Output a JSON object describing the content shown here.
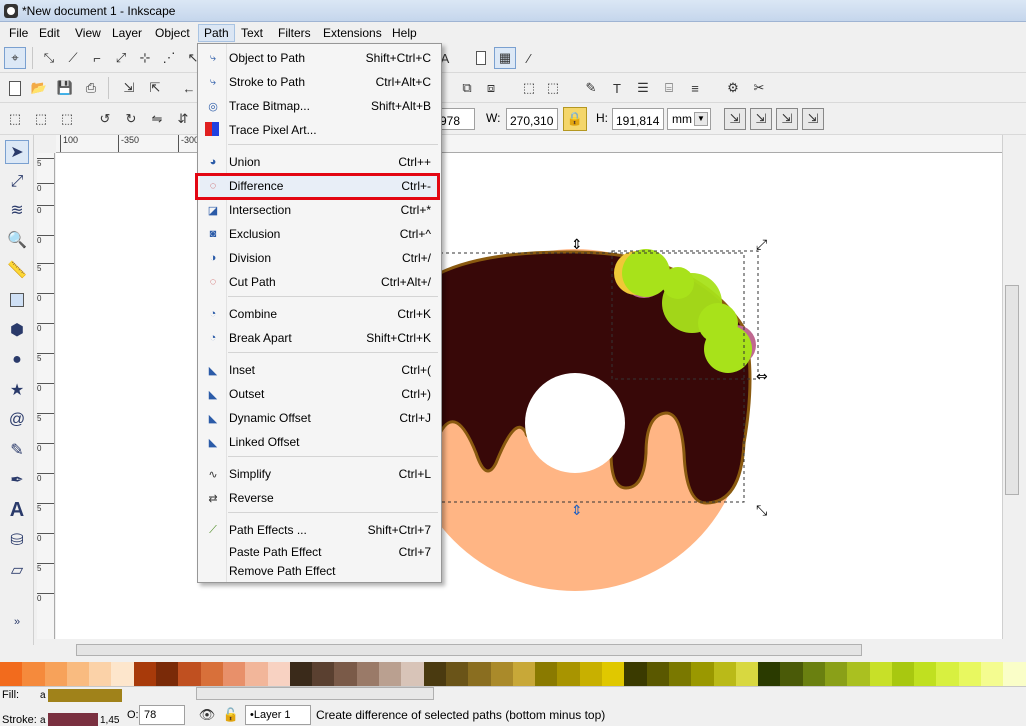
{
  "window": {
    "title": "*New document 1 - Inkscape"
  },
  "menubar": {
    "items": [
      "File",
      "Edit",
      "View",
      "Layer",
      "Object",
      "Path",
      "Text",
      "Filters",
      "Extensions",
      "Help"
    ],
    "active": "Path"
  },
  "path_menu": {
    "items": [
      {
        "label": "Object to Path",
        "shortcut": "Shift+Ctrl+C",
        "icon": "object-to-path-icon"
      },
      {
        "label": "Stroke to Path",
        "shortcut": "Ctrl+Alt+C",
        "icon": "stroke-to-path-icon"
      },
      {
        "label": "Trace Bitmap...",
        "shortcut": "Shift+Alt+B",
        "icon": "trace-bitmap-icon"
      },
      {
        "label": "Trace Pixel Art...",
        "shortcut": "",
        "icon": "trace-pixel-art-icon"
      },
      {
        "label": "Union",
        "shortcut": "Ctrl++",
        "icon": "union-icon"
      },
      {
        "label": "Difference",
        "shortcut": "Ctrl+-",
        "icon": "difference-icon"
      },
      {
        "label": "Intersection",
        "shortcut": "Ctrl+*",
        "icon": "intersection-icon"
      },
      {
        "label": "Exclusion",
        "shortcut": "Ctrl+^",
        "icon": "exclusion-icon"
      },
      {
        "label": "Division",
        "shortcut": "Ctrl+/",
        "icon": "division-icon"
      },
      {
        "label": "Cut Path",
        "shortcut": "Ctrl+Alt+/",
        "icon": "cut-path-icon"
      },
      {
        "label": "Combine",
        "shortcut": "Ctrl+K",
        "icon": "combine-icon"
      },
      {
        "label": "Break Apart",
        "shortcut": "Shift+Ctrl+K",
        "icon": "break-apart-icon"
      },
      {
        "label": "Inset",
        "shortcut": "Ctrl+(",
        "icon": "inset-icon"
      },
      {
        "label": "Outset",
        "shortcut": "Ctrl+)",
        "icon": "outset-icon"
      },
      {
        "label": "Dynamic Offset",
        "shortcut": "Ctrl+J",
        "icon": "dynamic-offset-icon"
      },
      {
        "label": "Linked Offset",
        "shortcut": "",
        "icon": "linked-offset-icon"
      },
      {
        "label": "Simplify",
        "shortcut": "Ctrl+L",
        "icon": "simplify-icon"
      },
      {
        "label": "Reverse",
        "shortcut": "",
        "icon": "reverse-icon"
      },
      {
        "label": "Path Effects ...",
        "shortcut": "Shift+Ctrl+7",
        "icon": "path-effects-icon"
      },
      {
        "label": "Paste Path Effect",
        "shortcut": "Ctrl+7",
        "icon": ""
      },
      {
        "label": "Remove Path Effect",
        "shortcut": "",
        "icon": ""
      }
    ],
    "highlighted": "Difference"
  },
  "selector_toolbar": {
    "y_value": "978",
    "w_label": "W:",
    "w_value": "270,310",
    "h_label": "H:",
    "h_value": "191,814",
    "unit": "mm"
  },
  "rulers": {
    "horizontal_ticks": [
      "100",
      "-350",
      "-300"
    ],
    "vertical_ticks": [
      "5",
      "0",
      "0",
      "0",
      "5",
      "0",
      "0",
      "5",
      "0",
      "5",
      "0",
      "0",
      "5",
      "0",
      "5",
      "0"
    ]
  },
  "status": {
    "fill_label": "Fill:",
    "fill_value": "a",
    "fill_color": "#a0821a",
    "stroke_label": "Stroke:",
    "stroke_value": "a",
    "stroke_color": "#7a3040",
    "stroke_width": "1,45",
    "opacity_label": "O:",
    "opacity_value": "78",
    "layer": "•Layer 1",
    "message": "Create difference of selected paths (bottom minus top)"
  },
  "palette": [
    "#f26b1d",
    "#f58a3c",
    "#f7a25a",
    "#f9bb80",
    "#fbd2a8",
    "#fde6cc",
    "#a83a0a",
    "#7a2a08",
    "#c05020",
    "#d8703a",
    "#e8906a",
    "#f2b69a",
    "#f8d2c2",
    "#3a2a1a",
    "#5a4030",
    "#7a5a48",
    "#9a7a68",
    "#baa090",
    "#d8c4b8",
    "#4a3a10",
    "#6a5418",
    "#8a6e20",
    "#aa8a2a",
    "#c8a838",
    "#8a7a00",
    "#a89400",
    "#c8b000",
    "#e0c800",
    "#3a3a00",
    "#5a5800",
    "#7a7800",
    "#9a9800",
    "#baba18",
    "#d8d840",
    "#2a3a00",
    "#4a5a08",
    "#6a8010",
    "#8aa018",
    "#aac020",
    "#c8e028",
    "#a8c810",
    "#c0e020",
    "#d8f040",
    "#e8f860",
    "#f4fc90",
    "#fafec8"
  ],
  "colors": {
    "icing": "#380808",
    "icing_outline": "#8a5a10",
    "dough": "#ffb584",
    "sprinkle": "#a8e21a",
    "highlight_red": "#e30613"
  }
}
